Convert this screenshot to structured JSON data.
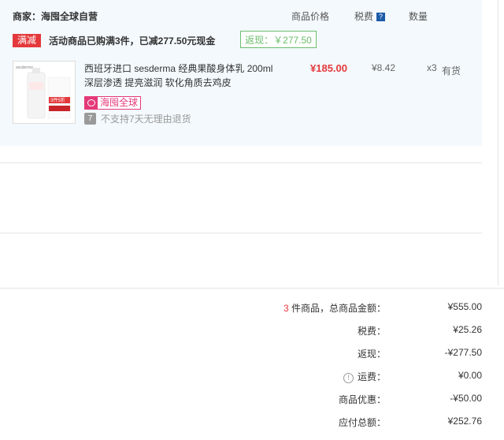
{
  "order": {
    "merchant_label": "商家：",
    "merchant_name": "海囤全球自营",
    "col_price": "商品价格",
    "col_tax": "税费",
    "tax_help": "?",
    "col_qty": "数量"
  },
  "promo": {
    "tag": "满减",
    "text": "活动商品已购满3件，已减277.50元现金",
    "rebate": "返现：￥277.50"
  },
  "item": {
    "image_alt_brand": "sesderma",
    "image_label": "3件5折",
    "title_line1": "西班牙进口 sesderma 经典果酸身体乳 200ml",
    "title_line2": "深层渗透 提亮滋润 软化角质去鸡皮",
    "price": "¥185.00",
    "tax": "¥8.42",
    "qty": "x3",
    "stock": "有货",
    "badge": "海囤全球",
    "return_icon": "7",
    "no_return": "不支持7天无理由退货"
  },
  "summary": {
    "count": "3",
    "count_suffix": "件商品，总商品金额：",
    "total": "¥555.00",
    "tax_label": "税费：",
    "tax": "¥25.26",
    "rebate_label": "返现：",
    "rebate": "-¥277.50",
    "shipping_label": "运费：",
    "shipping": "¥0.00",
    "discount_label": "商品优惠：",
    "discount": "-¥50.00",
    "payable_label": "应付总额：",
    "payable": "¥252.76"
  },
  "colors": {
    "accent_red": "#e4393c",
    "rebate_green": "#6cbc6c",
    "block_bg": "#f3f9fd"
  }
}
